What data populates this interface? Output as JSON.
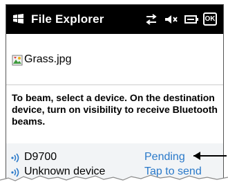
{
  "titlebar": {
    "title": "File Explorer",
    "ok_label": "OK"
  },
  "file": {
    "name": "Grass.jpg"
  },
  "instructions": "To beam, select a device. On the destination device, turn on visibility to receive Bluetooth beams.",
  "devices": [
    {
      "name": "D9700",
      "status": "Pending"
    },
    {
      "name": "Unknown device",
      "status": "Tap to send"
    }
  ],
  "colors": {
    "status_link": "#2a79c9",
    "bluetooth": "#2a79c9",
    "titlebar_bg": "#000000"
  },
  "icons": {
    "windows_logo": "windows-logo-icon",
    "connectivity": "connectivity-arrows-icon",
    "volume": "speaker-mute-icon",
    "battery": "battery-charging-icon",
    "file": "image-file-icon",
    "bluetooth": "bluetooth-icon"
  }
}
